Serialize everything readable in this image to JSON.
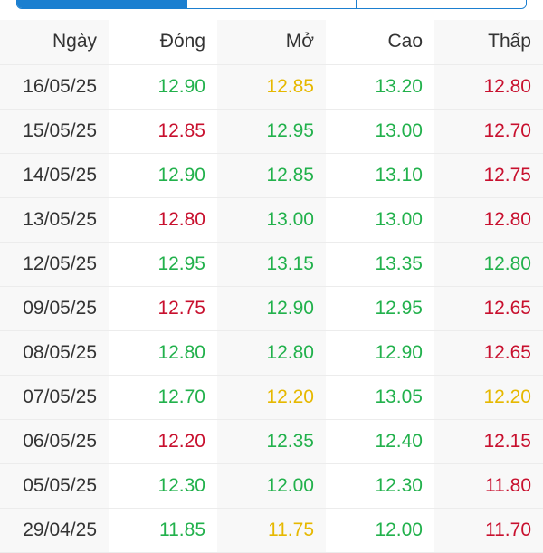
{
  "colors": {
    "up": "#22b14c",
    "down": "#c8102e",
    "ref": "#e6b800",
    "accent": "#1b7fd0"
  },
  "table": {
    "headers": [
      "Ngày",
      "Đóng",
      "Mở",
      "Cao",
      "Thấp"
    ],
    "rows": [
      {
        "date": "16/05/25",
        "close": "12.90",
        "close_c": "green",
        "open": "12.85",
        "open_c": "yellow",
        "high": "13.20",
        "high_c": "green",
        "low": "12.80",
        "low_c": "red"
      },
      {
        "date": "15/05/25",
        "close": "12.85",
        "close_c": "red",
        "open": "12.95",
        "open_c": "green",
        "high": "13.00",
        "high_c": "green",
        "low": "12.70",
        "low_c": "red"
      },
      {
        "date": "14/05/25",
        "close": "12.90",
        "close_c": "green",
        "open": "12.85",
        "open_c": "green",
        "high": "13.10",
        "high_c": "green",
        "low": "12.75",
        "low_c": "red"
      },
      {
        "date": "13/05/25",
        "close": "12.80",
        "close_c": "red",
        "open": "13.00",
        "open_c": "green",
        "high": "13.00",
        "high_c": "green",
        "low": "12.80",
        "low_c": "red"
      },
      {
        "date": "12/05/25",
        "close": "12.95",
        "close_c": "green",
        "open": "13.15",
        "open_c": "green",
        "high": "13.35",
        "high_c": "green",
        "low": "12.80",
        "low_c": "green"
      },
      {
        "date": "09/05/25",
        "close": "12.75",
        "close_c": "red",
        "open": "12.90",
        "open_c": "green",
        "high": "12.95",
        "high_c": "green",
        "low": "12.65",
        "low_c": "red"
      },
      {
        "date": "08/05/25",
        "close": "12.80",
        "close_c": "green",
        "open": "12.80",
        "open_c": "green",
        "high": "12.90",
        "high_c": "green",
        "low": "12.65",
        "low_c": "red"
      },
      {
        "date": "07/05/25",
        "close": "12.70",
        "close_c": "green",
        "open": "12.20",
        "open_c": "yellow",
        "high": "13.05",
        "high_c": "green",
        "low": "12.20",
        "low_c": "yellow"
      },
      {
        "date": "06/05/25",
        "close": "12.20",
        "close_c": "red",
        "open": "12.35",
        "open_c": "green",
        "high": "12.40",
        "high_c": "green",
        "low": "12.15",
        "low_c": "red"
      },
      {
        "date": "05/05/25",
        "close": "12.30",
        "close_c": "green",
        "open": "12.00",
        "open_c": "green",
        "high": "12.30",
        "high_c": "green",
        "low": "11.80",
        "low_c": "red"
      },
      {
        "date": "29/04/25",
        "close": "11.85",
        "close_c": "green",
        "open": "11.75",
        "open_c": "yellow",
        "high": "12.00",
        "high_c": "green",
        "low": "11.70",
        "low_c": "red"
      }
    ]
  }
}
